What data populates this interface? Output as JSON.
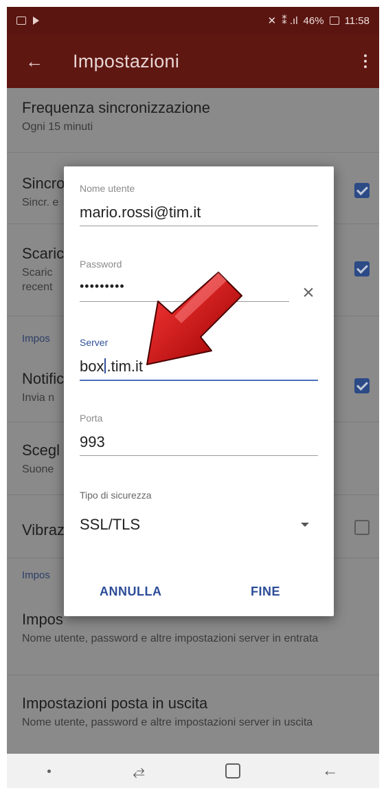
{
  "status_bar": {
    "battery": "46%",
    "time": "11:58",
    "signal_text": "⁑ .ıl"
  },
  "app_bar": {
    "back_icon": "←",
    "title": "Impostazioni",
    "overflow_icon": "more-vert-icon"
  },
  "settings": {
    "rows": [
      {
        "title": "Frequenza sincronizzazione",
        "subtitle": "Ogni 15 minuti"
      },
      {
        "title": "Sincro",
        "subtitle": "Sincr. e",
        "checked": true
      },
      {
        "title": "Scaric",
        "subtitle": "Scaric\nrecent",
        "checked": true
      },
      {
        "title": "Notific",
        "subtitle": "Invia n",
        "checked": true
      },
      {
        "title": "Scegl",
        "subtitle": "Suone"
      },
      {
        "title": "Vibraz",
        "checked": false
      },
      {
        "title": "Impos",
        "subtitle": "Nome utente, password e altre impostazioni server in entrata"
      },
      {
        "title": "Impostazioni posta in uscita",
        "subtitle": "Nome utente, password e altre impostazioni server in uscita"
      }
    ],
    "section_headers": [
      "Impos",
      "Impos"
    ]
  },
  "dialog": {
    "username_label": "Nome utente",
    "username_value": "mario.rossi@tim.it",
    "password_label": "Password",
    "password_value": "•••••••••",
    "clear_icon": "×",
    "server_label": "Server",
    "server_value_before_cursor": "box",
    "server_value_after_cursor": ".tim.it",
    "port_label": "Porta",
    "port_value": "993",
    "security_label": "Tipo di sicurezza",
    "security_value": "SSL/TLS",
    "cancel_label": "ANNULLA",
    "done_label": "FINE"
  },
  "nav_bar": {
    "recent_icon": "⥄",
    "back_icon": "←"
  },
  "colors": {
    "status_bar": "#5a1511",
    "app_bar": "#5f1712",
    "accent": "#2c4c97",
    "overlay": "#8a8a8a"
  }
}
